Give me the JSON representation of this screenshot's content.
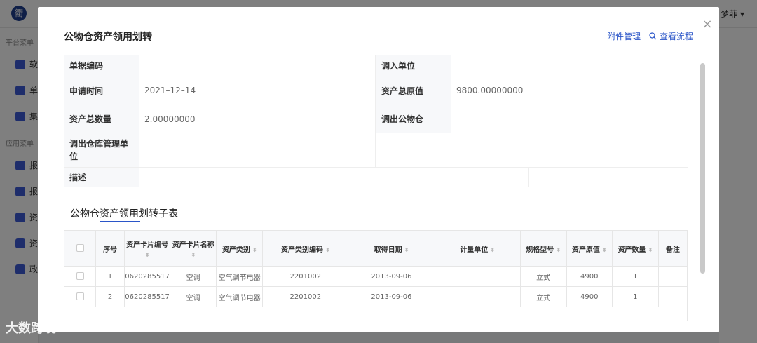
{
  "app": {
    "logo_char": "衢",
    "user_name": "梦菲",
    "side_group_platform": "平台菜单",
    "side_group_app": "应用菜单",
    "side_items": [
      "软",
      "单",
      "集",
      "报",
      "报",
      "资",
      "资",
      "政"
    ]
  },
  "modal": {
    "title": "公物仓资产领用划转",
    "actions": {
      "attachments": "附件管理",
      "flow": "查看流程"
    },
    "close": "×"
  },
  "form": {
    "doc_no_label": "单据编码",
    "doc_no_value": "",
    "in_unit_label": "调入单位",
    "in_unit_value": "",
    "apply_time_label": "申请时间",
    "apply_time_value": "2021–12–14",
    "orig_value_label": "资产总原值",
    "orig_value_value": "9800.00000000",
    "total_qty_label": "资产总数量",
    "total_qty_value": "2.00000000",
    "out_warehouse_label": "调出公物仓",
    "out_warehouse_value": "",
    "out_mgmt_label": "调出仓库管理单位",
    "out_mgmt_value": "",
    "desc_label": "描述",
    "desc_value": ""
  },
  "subtable": {
    "title": "公物仓资产领用划转子表",
    "columns": [
      "序号",
      "资产卡片编号",
      "资产卡片名称",
      "资产类别",
      "资产类别编码",
      "取得日期",
      "计量单位",
      "规格型号",
      "资产原值",
      "资产数量",
      "备注"
    ],
    "rows": [
      [
        "1",
        "0620285517",
        "空调",
        "空气调节电器",
        "2201002",
        "2013-09-06",
        "",
        "立式",
        "4900",
        "1",
        ""
      ],
      [
        "2",
        "0620285517",
        "空调",
        "空气调节电器",
        "2201002",
        "2013-09-06",
        "",
        "立式",
        "4900",
        "1",
        ""
      ]
    ]
  },
  "watermark": "大数跨境"
}
